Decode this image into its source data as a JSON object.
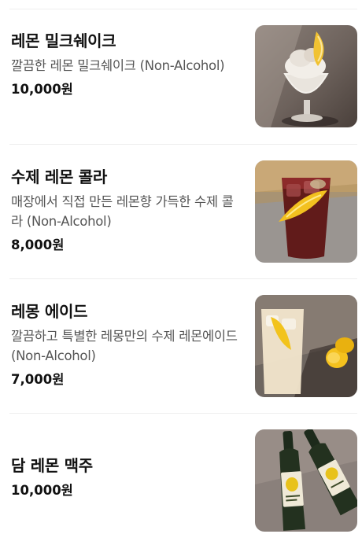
{
  "menu": {
    "items": [
      {
        "name": "레몬 밀크쉐이크",
        "description": "깔끔한 레몬 밀크쉐이크 (Non-Alcohol)",
        "price": "10,000원",
        "image_icon": "lemon-milkshake-photo"
      },
      {
        "name": "수제 레몬 콜라",
        "description": "매장에서 직접 만든 레몬향 가득한 수제 콜라 (Non-Alcohol)",
        "price": "8,000원",
        "image_icon": "lemon-cola-photo"
      },
      {
        "name": "레몽 에이드",
        "description": "깔끔하고 특별한 레몽만의 수제 레몬에이드 (Non-Alcohol)",
        "price": "7,000원",
        "image_icon": "lemonade-photo"
      },
      {
        "name": "담 레몬 맥주",
        "price": "10,000원",
        "image_icon": "lemon-beer-photo"
      }
    ]
  }
}
